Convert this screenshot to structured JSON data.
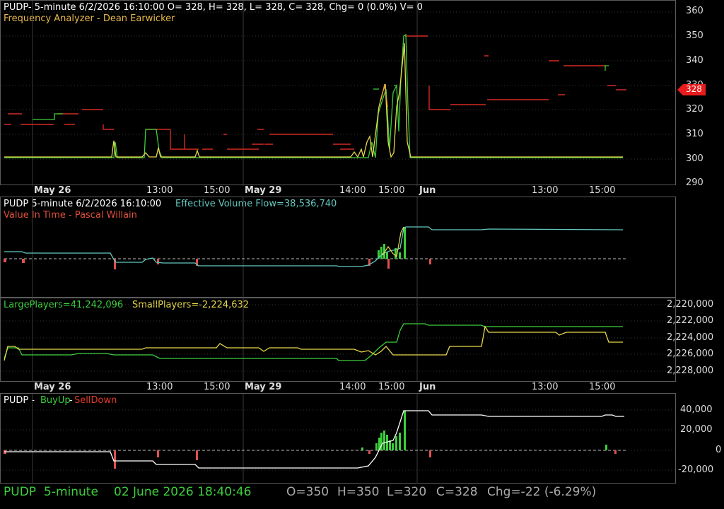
{
  "panel1": {
    "header": "PUDP- 5-minute 6/2/2026 16:10:00 O= 328, H= 328, L= 328, C= 328, Chg= 0 (0.0%) V= 0",
    "indicator": "Frequency Analyzer - Dean Earwicker",
    "y_ticks": [
      "360",
      "350",
      "340",
      "330",
      "320",
      "310",
      "300",
      "290"
    ],
    "last_price": "328"
  },
  "date_axis": {
    "labels": [
      {
        "text": "May 26",
        "bold": true
      },
      {
        "text": "13:00",
        "bold": false
      },
      {
        "text": "15:00",
        "bold": false
      },
      {
        "text": "May 29",
        "bold": true
      },
      {
        "text": "14:00",
        "bold": false
      },
      {
        "text": "15:00",
        "bold": false
      },
      {
        "text": "Jun",
        "bold": true
      },
      {
        "text": "13:00",
        "bold": false
      },
      {
        "text": "15:00",
        "bold": false
      }
    ]
  },
  "panel2": {
    "header": "PUDP 5-minute  6/2/2026 16:10:00",
    "flow": "Effective Volume Flow=38,536,740",
    "indicator": "Value In Time - Pascal Willain"
  },
  "panel3": {
    "large": "LargePlayers=41,242,096",
    "small": "SmallPlayers=-2,224,632",
    "y_ticks": [
      "2,220,000",
      "2,222,000",
      "2,224,000",
      "2,226,000",
      "2,228,000"
    ]
  },
  "panel4": {
    "symbol": "PUDP - ",
    "buy": "BuyUp",
    "dash": "-",
    "sell": "SellDown",
    "y_ticks": [
      "40,000",
      "20,000",
      "0",
      "-20,000"
    ]
  },
  "status": {
    "symbol": "PUDP",
    "interval": "5-minute",
    "datetime": "02 June 2026 18:40:46",
    "open": "O=350",
    "high": "H=350",
    "low": "L=320",
    "close": "C=328",
    "change": "Chg=-22 (-6.29%)"
  },
  "colors": {
    "green": "#3ccf3c",
    "red": "#e03a2a",
    "yellow": "#e8d84a",
    "cyan": "#63c8c0",
    "orange": "#e69b30",
    "white": "#ffffff"
  }
}
